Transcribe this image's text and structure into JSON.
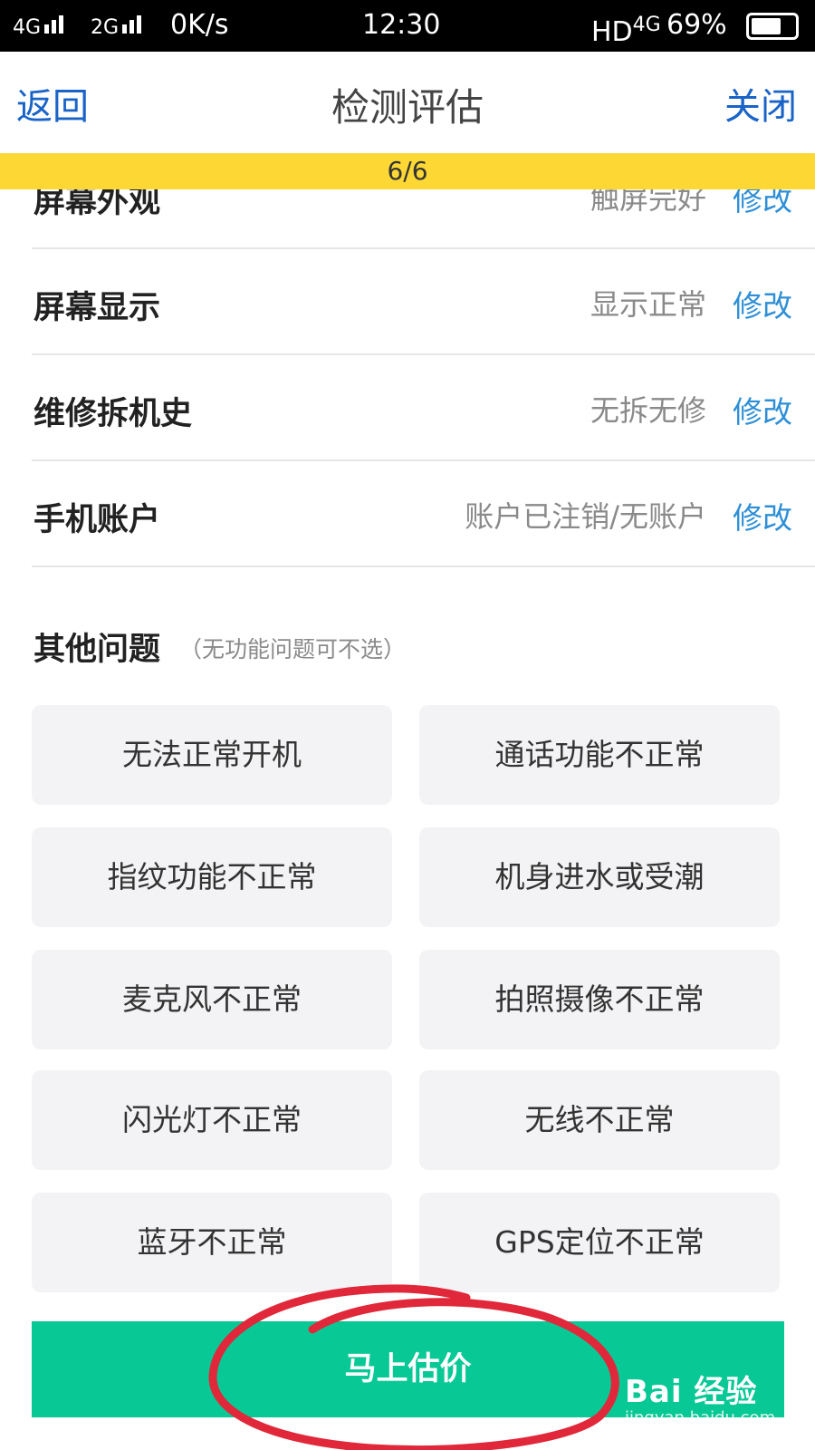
{
  "status_bar": {
    "network_left": "4G",
    "network_mid": "2G",
    "speed": "0K/s",
    "time": "12:30",
    "hd_label": "HD",
    "network_right": "4G",
    "battery_percent": "69%",
    "battery_level": 0.69
  },
  "nav": {
    "back_label": "返回",
    "title": "检测评估",
    "close_label": "关闭"
  },
  "progress": {
    "label": "6/6"
  },
  "items": [
    {
      "label": "屏幕外观",
      "value": "触屏完好",
      "edit": "修改"
    },
    {
      "label": "屏幕显示",
      "value": "显示正常",
      "edit": "修改"
    },
    {
      "label": "维修拆机史",
      "value": "无拆无修",
      "edit": "修改"
    },
    {
      "label": "手机账户",
      "value": "账户已注销/无账户",
      "edit": "修改"
    }
  ],
  "other_issues": {
    "title": "其他问题",
    "hint": "（无功能问题可不选）",
    "options": [
      "无法正常开机",
      "通话功能不正常",
      "指纹功能不正常",
      "机身进水或受潮",
      "麦克风不正常",
      "拍照摄像不正常",
      "闪光灯不正常",
      "无线不正常",
      "蓝牙不正常",
      "GPS定位不正常"
    ]
  },
  "cta": {
    "label": "马上估价"
  },
  "watermark": {
    "logo": "Bai 经验",
    "sub": "jingyan.baidu.com"
  },
  "colors": {
    "nav_link": "#1a64c8",
    "edit_link": "#2e8fd6",
    "progress_bar": "#fdd835",
    "cta": "#08c896",
    "annotation": "#e0283a"
  }
}
